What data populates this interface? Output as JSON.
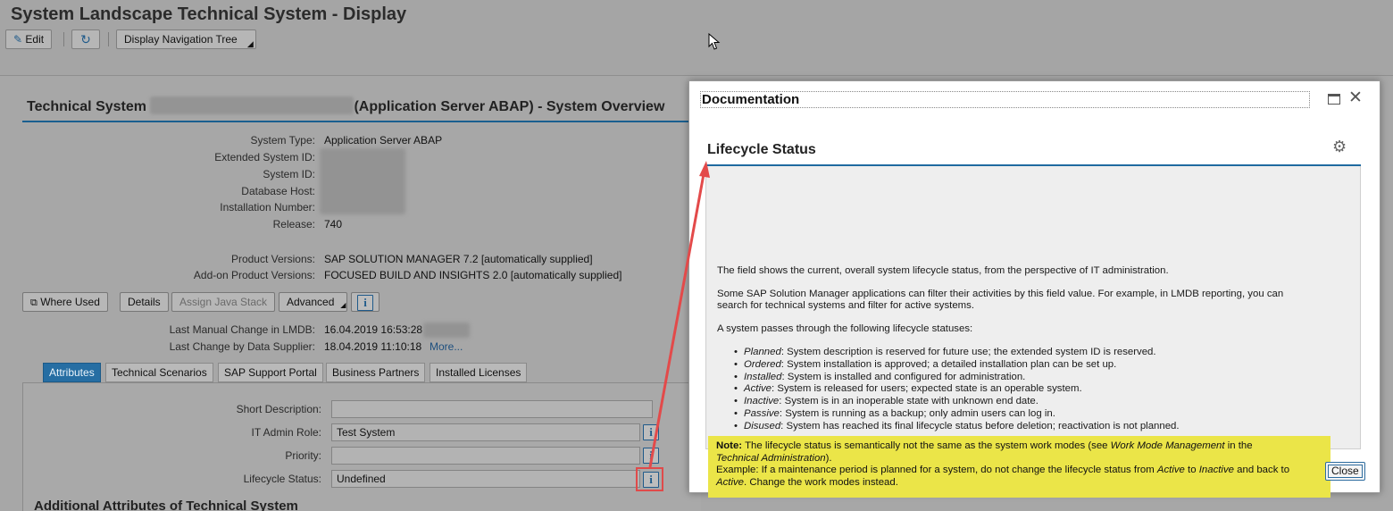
{
  "app": {
    "title": "System Landscape Technical System - Display"
  },
  "toolbar": {
    "edit_label": "Edit",
    "refresh_icon": "refresh-icon",
    "nav_tree_label": "Display Navigation Tree"
  },
  "section": {
    "title_prefix": "Technical System",
    "title_suffix": "(Application Server ABAP) - System Overview"
  },
  "overview": {
    "system_type_label": "System Type:",
    "system_type_value": "Application Server ABAP",
    "ext_sid_label": "Extended System ID:",
    "sid_label": "System ID:",
    "db_host_label": "Database Host:",
    "install_no_label": "Installation Number:",
    "release_label": "Release:",
    "release_value": "740",
    "product_versions_label": "Product Versions:",
    "product_versions_value": "SAP SOLUTION MANAGER 7.2 [automatically supplied]",
    "addon_label": "Add-on Product Versions:",
    "addon_value": "FOCUSED BUILD AND INSIGHTS 2.0 [automatically supplied]"
  },
  "actions": {
    "where_used": "Where Used",
    "details": "Details",
    "assign_java": "Assign Java Stack",
    "advanced": "Advanced"
  },
  "changes": {
    "manual_label": "Last Manual Change in LMDB:",
    "manual_value": "16.04.2019 16:53:28",
    "supplier_label": "Last Change by Data Supplier:",
    "supplier_value": "18.04.2019 11:10:18",
    "more_link": "More..."
  },
  "tabs": [
    "Attributes",
    "Technical Scenarios",
    "SAP Support Portal",
    "Business Partners",
    "Installed Licenses"
  ],
  "attributes": {
    "short_desc_label": "Short Description:",
    "short_desc_value": "",
    "it_admin_label": "IT Admin Role:",
    "it_admin_value": "Test System",
    "priority_label": "Priority:",
    "priority_value": "",
    "lifecycle_label": "Lifecycle Status:",
    "lifecycle_value": "Undefined",
    "additional_title": "Additional Attributes of Technical System"
  },
  "dialog": {
    "title": "Documentation",
    "heading": "Lifecycle Status",
    "p1": "The field shows the current, overall system lifecycle status, from the perspective of IT administration.",
    "p2a": "Some SAP Solution Manager applications can filter their activities by this field value. For example, in LMDB reporting, you can",
    "p2b": "search for technical systems and filter for active systems.",
    "p3": "A system passes through the following lifecycle statuses:",
    "statuses": [
      {
        "term": "Planned",
        "desc": ": System description is reserved for future use; the extended system ID is reserved."
      },
      {
        "term": "Ordered",
        "desc": ": System installation is approved; a detailed installation plan can be set up."
      },
      {
        "term": "Installed",
        "desc": ": System is installed and configured for administration."
      },
      {
        "term": "Active",
        "desc": ": System is released for users; expected state is an operable system."
      },
      {
        "term": "Inactive",
        "desc": ": System is in an inoperable state with unknown end date."
      },
      {
        "term": "Passive",
        "desc": ": System is running as a backup; only admin users can log in."
      },
      {
        "term": "Disused",
        "desc": ": System has reached its final lifecycle status before deletion; reactivation is not planned."
      }
    ],
    "note": {
      "label": "Note:",
      "text1": " The lifecycle status is semantically not the same as the system work modes (see ",
      "ref1": "Work Mode Management",
      "text2": " in the",
      "ref2": "Technical Administration",
      "text3": ").",
      "ex1": "Example: If a maintenance period is planned for a system, do not change the lifecycle status from ",
      "ex_active": "Active",
      "ex_to": " to ",
      "ex_inactive": "Inactive",
      "ex2": " and back to",
      "ex_active2": "Active",
      "ex3": ". Change the work modes instead."
    },
    "close_label": "Close"
  }
}
